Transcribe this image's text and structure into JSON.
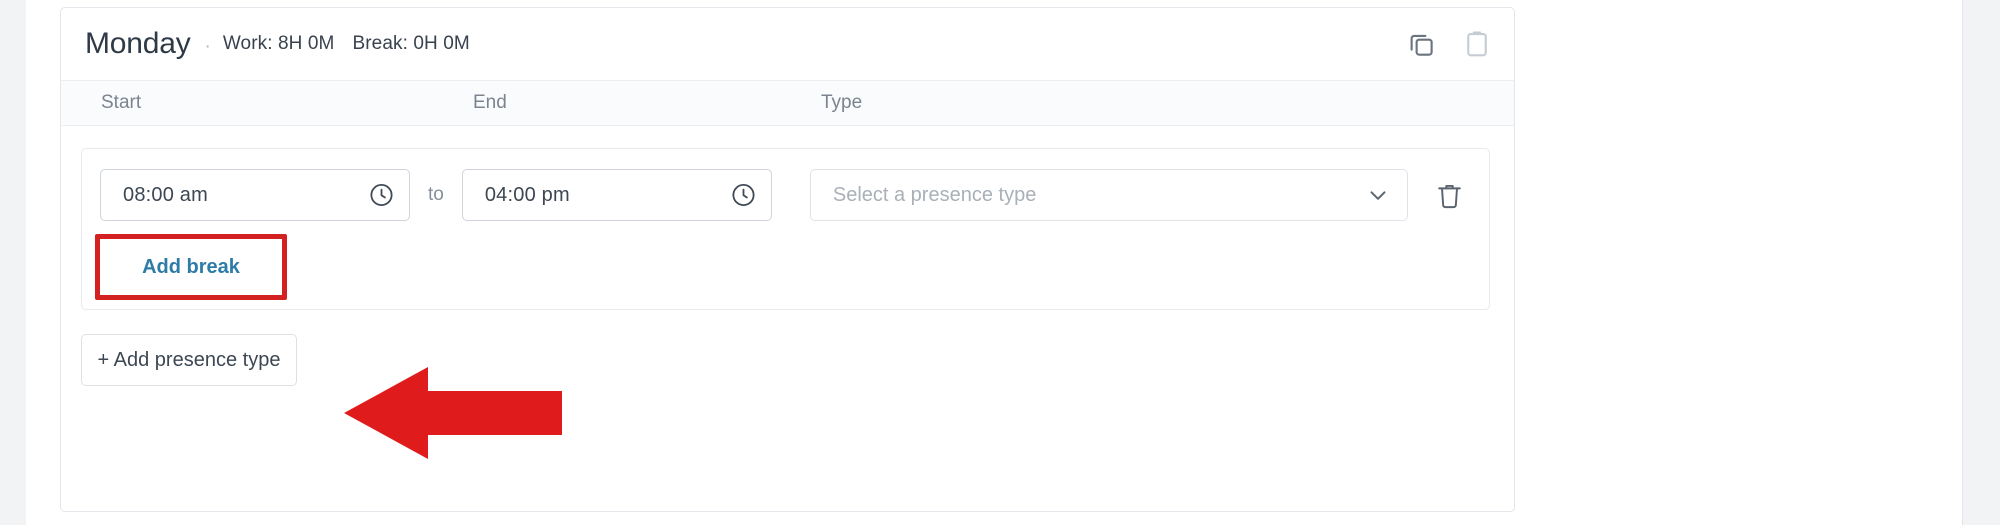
{
  "header": {
    "day": "Monday",
    "separator": "·",
    "work_label": "Work: 8H 0M",
    "break_label": "Break: 0H 0M",
    "duplicate_icon": "copy-icon",
    "paste_icon": "clipboard-icon"
  },
  "columns": {
    "start": "Start",
    "end": "End",
    "type": "Type"
  },
  "entry": {
    "start_time": "08:00 am",
    "to": "to",
    "end_time": "04:00 pm",
    "type_placeholder": "Select a presence type",
    "start_clock_icon": "clock-icon",
    "end_clock_icon": "clock-icon",
    "chevron_icon": "chevron-down-icon",
    "delete_icon": "trash-icon"
  },
  "actions": {
    "add_break": "Add break",
    "add_presence_type": "+ Add presence type"
  },
  "annotation": {
    "highlight_color": "#d32121",
    "arrow_color": "#e01b1b",
    "target": "add-break"
  },
  "colors": {
    "link": "#2d7ca8",
    "text": "#3d4753",
    "muted": "#7b848f",
    "placeholder": "#a9b0b8",
    "border": "#e3e6ea",
    "header_bg": "#fafbfc"
  }
}
